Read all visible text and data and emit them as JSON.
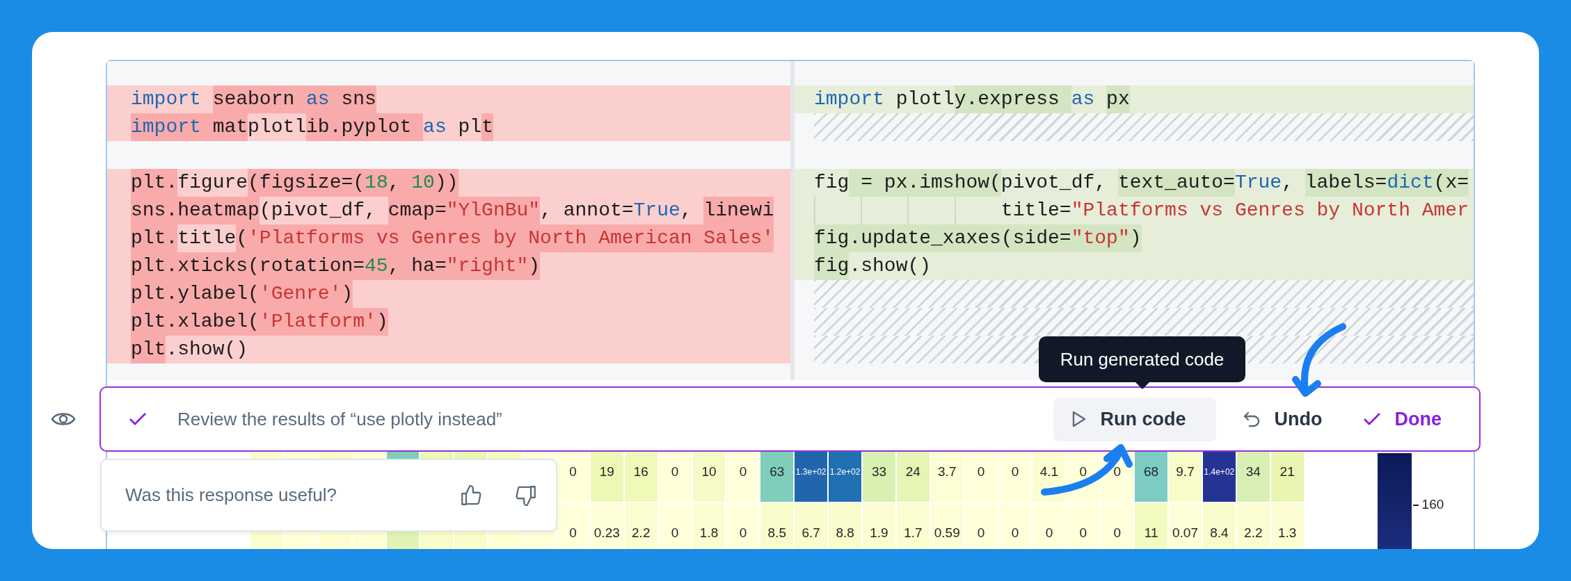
{
  "diff": {
    "left_lines": [
      {
        "kind": "code",
        "segments": [
          {
            "text": "import ",
            "kind": "keyword",
            "highlight": false
          },
          {
            "text": "seaborn ",
            "kind": "plain",
            "highlight": true
          },
          {
            "text": "as",
            "kind": "keyword",
            "highlight": true
          },
          {
            "text": " sns",
            "kind": "plain",
            "highlight": true
          }
        ]
      },
      {
        "kind": "code",
        "segments": [
          {
            "text": "import ",
            "kind": "keyword",
            "highlight": true
          },
          {
            "text": "mat",
            "kind": "plain",
            "highlight": true
          },
          {
            "text": "plotl",
            "kind": "plain",
            "highlight": false
          },
          {
            "text": "ib.pyplot ",
            "kind": "plain",
            "highlight": true
          },
          {
            "text": "as",
            "kind": "keyword",
            "highlight": false
          },
          {
            "text": " pl",
            "kind": "plain",
            "highlight": false
          },
          {
            "text": "t",
            "kind": "plain",
            "highlight": true
          }
        ]
      },
      {
        "kind": "blank"
      },
      {
        "kind": "code",
        "segments": [
          {
            "text": "plt.",
            "kind": "plain",
            "highlight": true
          },
          {
            "text": "figure",
            "kind": "plain",
            "highlight": false
          },
          {
            "text": "(figsize=(",
            "kind": "plain",
            "highlight": true
          },
          {
            "text": "18",
            "kind": "number",
            "highlight": true
          },
          {
            "text": ", ",
            "kind": "plain",
            "highlight": true
          },
          {
            "text": "10",
            "kind": "number",
            "highlight": true
          },
          {
            "text": "))",
            "kind": "plain",
            "highlight": true
          }
        ]
      },
      {
        "kind": "code",
        "segments": [
          {
            "text": "sns.heatmap",
            "kind": "plain",
            "highlight": true
          },
          {
            "text": "(pivot_df, ",
            "kind": "plain",
            "highlight": false
          },
          {
            "text": "cmap=",
            "kind": "plain",
            "highlight": true
          },
          {
            "text": "\"YlGnBu\"",
            "kind": "string",
            "highlight": true
          },
          {
            "text": ", annot=",
            "kind": "plain",
            "highlight": false
          },
          {
            "text": "True",
            "kind": "keyword",
            "highlight": false
          },
          {
            "text": ", ",
            "kind": "plain",
            "highlight": false
          },
          {
            "text": "linewi",
            "kind": "plain",
            "highlight": true
          }
        ]
      },
      {
        "kind": "code",
        "segments": [
          {
            "text": "plt.",
            "kind": "plain",
            "highlight": true
          },
          {
            "text": "title",
            "kind": "plain",
            "highlight": false
          },
          {
            "text": "(",
            "kind": "plain",
            "highlight": true
          },
          {
            "text": "'Platforms vs Genres by North American Sales'",
            "kind": "string",
            "highlight": true
          }
        ]
      },
      {
        "kind": "code",
        "segments": [
          {
            "text": "plt.xticks(rotation=",
            "kind": "plain",
            "highlight": true
          },
          {
            "text": "45",
            "kind": "number",
            "highlight": true
          },
          {
            "text": ", ha=",
            "kind": "plain",
            "highlight": true
          },
          {
            "text": "\"right\"",
            "kind": "string",
            "highlight": true
          },
          {
            "text": ")",
            "kind": "plain",
            "highlight": true
          }
        ]
      },
      {
        "kind": "code",
        "segments": [
          {
            "text": "plt.ylabel(",
            "kind": "plain",
            "highlight": true
          },
          {
            "text": "'Genre'",
            "kind": "string",
            "highlight": true
          },
          {
            "text": ")",
            "kind": "plain",
            "highlight": true
          }
        ]
      },
      {
        "kind": "code",
        "segments": [
          {
            "text": "plt.xlabel(",
            "kind": "plain",
            "highlight": true
          },
          {
            "text": "'Platform'",
            "kind": "string",
            "highlight": true
          },
          {
            "text": ")",
            "kind": "plain",
            "highlight": true
          }
        ]
      },
      {
        "kind": "code",
        "segments": [
          {
            "text": "plt",
            "kind": "plain",
            "highlight": true
          },
          {
            "text": ".show()",
            "kind": "plain",
            "highlight": false
          }
        ]
      }
    ],
    "right_lines": [
      {
        "kind": "code",
        "segments": [
          {
            "text": "import",
            "kind": "keyword",
            "highlight": false
          },
          {
            "text": " plotl",
            "kind": "plain",
            "highlight": false
          },
          {
            "text": "y.express ",
            "kind": "plain",
            "highlight": true
          },
          {
            "text": "as ",
            "kind": "keyword",
            "highlight": false
          },
          {
            "text": "px",
            "kind": "plain",
            "highlight": true
          }
        ]
      },
      {
        "kind": "filler"
      },
      {
        "kind": "blank"
      },
      {
        "kind": "code",
        "segments": [
          {
            "text": "fig",
            "kind": "plain",
            "highlight": false
          },
          {
            "text": " = px.imshow(",
            "kind": "plain",
            "highlight": true
          },
          {
            "text": "pivot_df, ",
            "kind": "plain",
            "highlight": false
          },
          {
            "text": "text_auto=",
            "kind": "plain",
            "highlight": true
          },
          {
            "text": "True",
            "kind": "keyword",
            "highlight": false
          },
          {
            "text": ", ",
            "kind": "plain",
            "highlight": false
          },
          {
            "text": "labels=",
            "kind": "plain",
            "highlight": true
          },
          {
            "text": "dict",
            "kind": "keyword",
            "highlight": true
          },
          {
            "text": "(x=",
            "kind": "plain",
            "highlight": true
          }
        ]
      },
      {
        "kind": "wrapped",
        "segments": [
          {
            "text": "title=",
            "kind": "plain",
            "highlight": false
          },
          {
            "text": "\"Platforms vs Genres by North Amer",
            "kind": "string",
            "highlight": false
          }
        ]
      },
      {
        "kind": "code",
        "segments": [
          {
            "text": "fig.update_xaxes(side=",
            "kind": "plain",
            "highlight": true
          },
          {
            "text": "\"top\"",
            "kind": "string",
            "highlight": true
          },
          {
            "text": ")",
            "kind": "plain",
            "highlight": true
          }
        ]
      },
      {
        "kind": "code",
        "segments": [
          {
            "text": "fig",
            "kind": "plain",
            "highlight": true
          },
          {
            "text": ".show()",
            "kind": "plain",
            "highlight": false
          }
        ]
      },
      {
        "kind": "filler"
      },
      {
        "kind": "filler"
      },
      {
        "kind": "filler"
      }
    ]
  },
  "heatmap": {
    "rows": [
      {
        "cells": [
          {
            "color": "#fbfdd0"
          },
          {
            "color": "#ffffd9"
          },
          {
            "color": "#f8fcc9"
          },
          {
            "color": "#ffffd9"
          },
          {
            "color": "#7fcdbb"
          },
          {
            "color": "#eef8b5"
          },
          {
            "color": "#eaf7b1"
          },
          {
            "color": "#f3fabf"
          },
          {
            "color": "#ffffd9"
          },
          {
            "value": "0",
            "color": "#ffffd9"
          },
          {
            "value": "19",
            "color": "#eef8b5"
          },
          {
            "value": "16",
            "color": "#f0f9b8"
          },
          {
            "value": "0",
            "color": "#ffffd9"
          },
          {
            "value": "10",
            "color": "#f6fbc6"
          },
          {
            "value": "0",
            "color": "#ffffd9"
          },
          {
            "value": "63",
            "color": "#7fcdbb"
          },
          {
            "value": "1.3e+02",
            "color": "#2166ac"
          },
          {
            "value": "1.2e+02",
            "color": "#2170b2"
          },
          {
            "value": "33",
            "color": "#d9f0b3"
          },
          {
            "value": "24",
            "color": "#e5f5b3"
          },
          {
            "value": "3.7",
            "color": "#fcfed3"
          },
          {
            "value": "0",
            "color": "#ffffd9"
          },
          {
            "value": "0",
            "color": "#ffffd9"
          },
          {
            "value": "4.1",
            "color": "#fbfdd0"
          },
          {
            "value": "0",
            "color": "#ffffd9"
          },
          {
            "value": "0",
            "color": "#ffffd9"
          },
          {
            "value": "68",
            "color": "#7dccc4"
          },
          {
            "value": "9.7",
            "color": "#f7fcc8"
          },
          {
            "value": "1.4e+02",
            "color": "#253494"
          },
          {
            "value": "34",
            "color": "#d8efb4"
          },
          {
            "value": "21",
            "color": "#e8f6b1"
          }
        ]
      },
      {
        "cells": [
          {
            "color": "#fbfdd0"
          },
          {
            "color": "#ffffd9"
          },
          {
            "color": "#fcfed2"
          },
          {
            "color": "#fdfed6"
          },
          {
            "color": "#e1f3b2"
          },
          {
            "color": "#f7fcc8"
          },
          {
            "color": "#f7fcc8"
          },
          {
            "color": "#fcfed3"
          },
          {
            "color": "#ffffd9"
          },
          {
            "value": "0",
            "color": "#ffffd9"
          },
          {
            "value": "0.23",
            "color": "#fefed8"
          },
          {
            "value": "2.2",
            "color": "#fbfdd0"
          },
          {
            "value": "0",
            "color": "#ffffd9"
          },
          {
            "value": "1.8",
            "color": "#fbfdd0"
          },
          {
            "value": "0",
            "color": "#ffffd9"
          },
          {
            "value": "8.5",
            "color": "#f8fcca"
          },
          {
            "value": "6.7",
            "color": "#f9fccc"
          },
          {
            "value": "8.8",
            "color": "#f8fcca"
          },
          {
            "value": "1.9",
            "color": "#fbfdd0"
          },
          {
            "value": "1.7",
            "color": "#fbfdd0"
          },
          {
            "value": "0.59",
            "color": "#fdfed6"
          },
          {
            "value": "0",
            "color": "#ffffd9"
          },
          {
            "value": "0",
            "color": "#ffffd9"
          },
          {
            "value": "0",
            "color": "#ffffd9"
          },
          {
            "value": "0",
            "color": "#ffffd9"
          },
          {
            "value": "0",
            "color": "#ffffd9"
          },
          {
            "value": "11",
            "color": "#f3fabf"
          },
          {
            "value": "0.07",
            "color": "#fefed8"
          },
          {
            "value": "8.4",
            "color": "#f8fcca"
          },
          {
            "value": "2.2",
            "color": "#fbfdd0"
          },
          {
            "value": "1.3",
            "color": "#fcfed2"
          }
        ]
      }
    ],
    "colorbar_tick": "160"
  },
  "review_bar": {
    "message": "Review the results of “use plotly instead”",
    "buttons": [
      {
        "label": "Run code",
        "kind": "run"
      },
      {
        "label": "Undo",
        "kind": "undo"
      },
      {
        "label": "Done",
        "kind": "done"
      }
    ]
  },
  "tooltip": {
    "text": "Run generated code"
  },
  "feedback": {
    "question": "Was this response useful?"
  }
}
